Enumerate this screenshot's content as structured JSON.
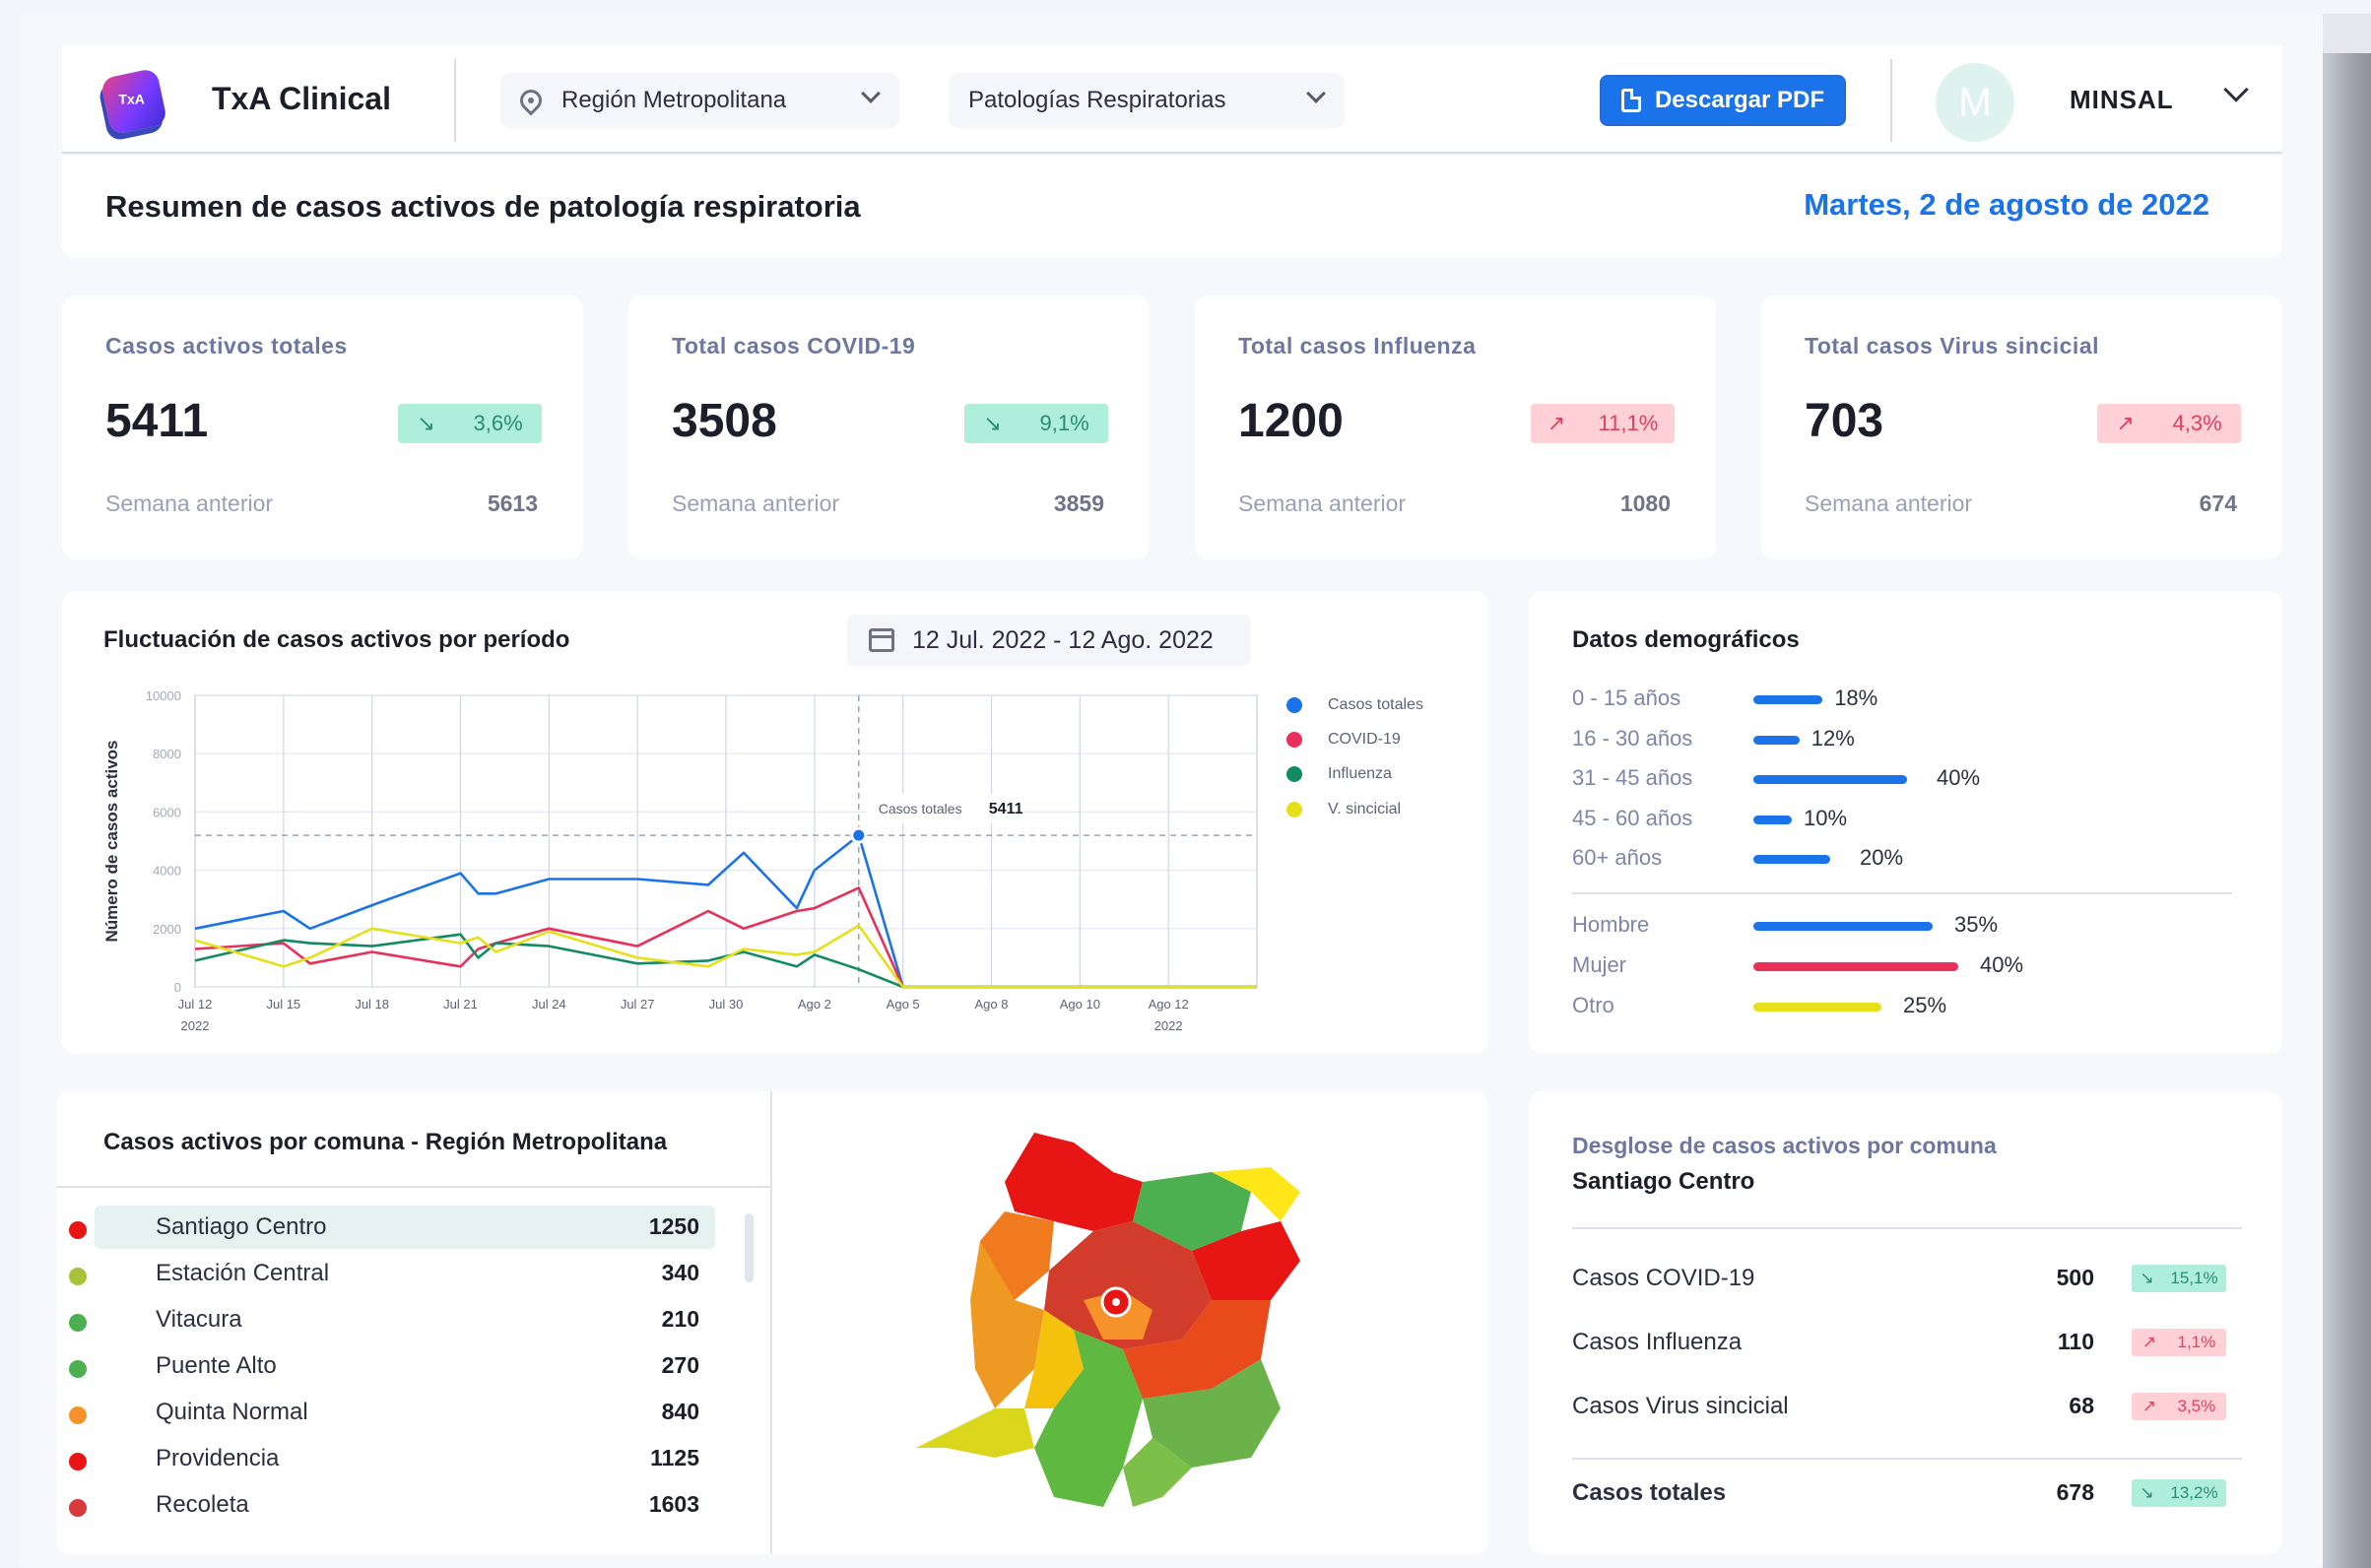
{
  "app": {
    "title": "TxA Clinical",
    "logo_text": "TxA",
    "region_select": "Región Metropolitana",
    "pathology_select": "Patologías Respiratorias",
    "pdf_button": "Descargar PDF",
    "avatar_initial": "M",
    "user_name": "MINSAL"
  },
  "header": {
    "title": "Resumen de casos activos de patología respiratoria",
    "date": "Martes, 2 de agosto de 2022"
  },
  "kpis": [
    {
      "title": "Casos activos totales",
      "value": "5411",
      "trend": "↘",
      "pct": "3,6%",
      "direction": "down",
      "prev_label": "Semana anterior",
      "prev_value": "5613"
    },
    {
      "title": "Total casos COVID-19",
      "value": "3508",
      "trend": "↘",
      "pct": "9,1%",
      "direction": "down",
      "prev_label": "Semana anterior",
      "prev_value": "3859"
    },
    {
      "title": "Total casos Influenza",
      "value": "1200",
      "trend": "↗",
      "pct": "11,1%",
      "direction": "up",
      "prev_label": "Semana anterior",
      "prev_value": "1080"
    },
    {
      "title": "Total casos Virus sincicial",
      "value": "703",
      "trend": "↗",
      "pct": "4,3%",
      "direction": "up",
      "prev_label": "Semana anterior",
      "prev_value": "674"
    }
  ],
  "chart_card": {
    "title": "Fluctuación de casos activos por período",
    "date_range": "12 Jul. 2022 - 12 Ago. 2022",
    "tooltip_label": "Casos totales",
    "tooltip_value": "5411"
  },
  "chart_data": {
    "type": "line",
    "ylabel": "Número de casos activos",
    "ylim": [
      0,
      10000
    ],
    "yticks": [
      "10000",
      "8000",
      "6000",
      "4000",
      "2000",
      "0"
    ],
    "x_labels": [
      "Jul 12",
      "Jul 15",
      "Jul 18",
      "Jul 21",
      "Jul 24",
      "Jul 27",
      "Jul 30",
      "Ago 2",
      "Ago 5",
      "Ago 8",
      "Ago 10",
      "Ago 12"
    ],
    "x_sublabels": [
      "2022",
      "",
      "",
      "",
      "",
      "",
      "",
      "",
      "",
      "",
      "",
      "2022"
    ],
    "x": [
      0,
      1,
      1.3,
      2,
      3,
      3.2,
      3.4,
      4,
      5,
      5.8,
      6.2,
      6.8,
      7,
      7.5,
      12
    ],
    "series": [
      {
        "name": "Casos totales",
        "color": "#1a73e8",
        "values": [
          2000,
          2600,
          2000,
          2800,
          3900,
          3200,
          3200,
          3700,
          3700,
          3500,
          4600,
          2700,
          4000,
          5200,
          0
        ]
      },
      {
        "name": "COVID-19",
        "color": "#e8305a",
        "values": [
          1300,
          1500,
          800,
          1200,
          700,
          1300,
          1500,
          2000,
          1400,
          2600,
          2000,
          2600,
          2700,
          3400,
          0
        ]
      },
      {
        "name": "Influenza",
        "color": "#138a63",
        "values": [
          900,
          1600,
          1500,
          1400,
          1800,
          1000,
          1500,
          1400,
          800,
          900,
          1200,
          700,
          1100,
          600,
          0
        ]
      },
      {
        "name": "V. sincicial",
        "color": "#e6e01a",
        "values": [
          1600,
          700,
          1000,
          2000,
          1500,
          1700,
          1200,
          1900,
          1000,
          700,
          1300,
          1100,
          1200,
          2100,
          0
        ]
      }
    ],
    "highlight_x": 7.5,
    "highlight_y": 5200
  },
  "demographics": {
    "title": "Datos demográficos",
    "age": [
      {
        "label": "0 - 15 años",
        "pct": "18%",
        "value": 18,
        "color": "#1a73e8"
      },
      {
        "label": "16 - 30 años",
        "pct": "12%",
        "value": 12,
        "color": "#1a73e8"
      },
      {
        "label": "31 - 45 años",
        "pct": "40%",
        "value": 40,
        "color": "#1a73e8"
      },
      {
        "label": "45 - 60 años",
        "pct": "10%",
        "value": 10,
        "color": "#1a73e8"
      },
      {
        "label": "60+ años",
        "pct": "20%",
        "value": 20,
        "color": "#1a73e8"
      }
    ],
    "gender": [
      {
        "label": "Hombre",
        "pct": "35%",
        "value": 35,
        "color": "#1a73e8"
      },
      {
        "label": "Mujer",
        "pct": "40%",
        "value": 40,
        "color": "#e8305a"
      },
      {
        "label": "Otro",
        "pct": "25%",
        "value": 25,
        "color": "#e6e01a"
      }
    ]
  },
  "comunas": {
    "title": "Casos activos por comuna - Región Metropolitana",
    "items": [
      {
        "name": "Santiago Centro",
        "value": "1250",
        "color": "#e81515"
      },
      {
        "name": "Estación Central",
        "value": "340",
        "color": "#a8c23a"
      },
      {
        "name": "Vitacura",
        "value": "210",
        "color": "#4caf50"
      },
      {
        "name": "Puente Alto",
        "value": "270",
        "color": "#4caf50"
      },
      {
        "name": "Quinta Normal",
        "value": "840",
        "color": "#f5932a"
      },
      {
        "name": "Providencia",
        "value": "1125",
        "color": "#e81515"
      },
      {
        "name": "Recoleta",
        "value": "1603",
        "color": "#d63a3a"
      }
    ]
  },
  "breakdown": {
    "title": "Desglose de casos activos por comuna",
    "comuna": "Santiago Centro",
    "rows": [
      {
        "label": "Casos COVID-19",
        "value": "500",
        "trend": "↘",
        "pct": "15,1%",
        "direction": "down"
      },
      {
        "label": "Casos Influenza",
        "value": "110",
        "trend": "↗",
        "pct": "1,1%",
        "direction": "up"
      },
      {
        "label": "Casos Virus sincicial",
        "value": "68",
        "trend": "↗",
        "pct": "3,5%",
        "direction": "up"
      }
    ],
    "total": {
      "label": "Casos totales",
      "value": "678",
      "trend": "↘",
      "pct": "13,2%",
      "direction": "down"
    }
  }
}
